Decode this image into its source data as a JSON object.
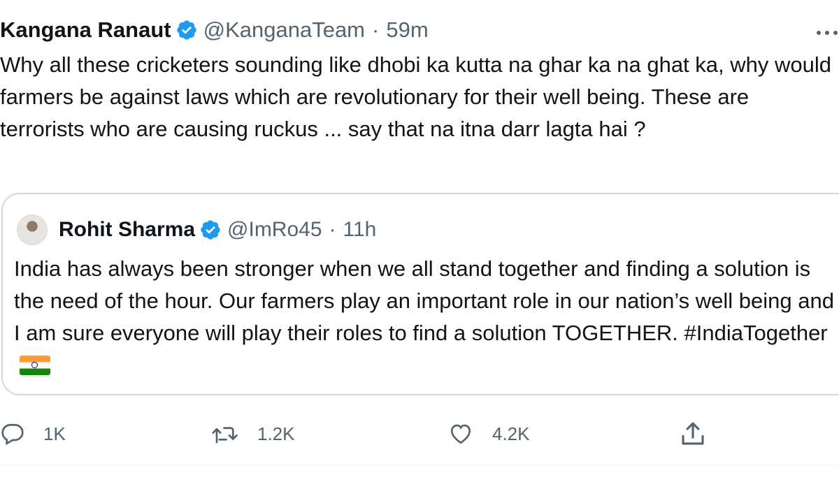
{
  "tweet": {
    "author_name": "Kangana Ranaut",
    "handle": "@KanganaTeam",
    "separator": "·",
    "time": "59m",
    "text": "Why all these cricketers sounding like dhobi ka kutta na ghar ka na ghat ka, why would farmers be against laws which are revolutionary for their well being. These are terrorists who are causing ruckus ... say that na itna darr lagta hai ?",
    "icons": {
      "verified": "verified-badge-icon",
      "more": "more-options-icon"
    }
  },
  "quote": {
    "author_name": "Rohit Sharma",
    "handle": "@ImRo45",
    "separator": "·",
    "time": "11h",
    "text": "India has always been stronger when we all stand together and finding a solution is the need of the hour. Our farmers play an important role in our nation’s well being and I am sure everyone will play their roles to find a solution TOGETHER. #IndiaTogether",
    "emoji": "india-flag-icon"
  },
  "actions": {
    "reply_count": "1K",
    "retweet_count": "1.2K",
    "like_count": "4.2K",
    "share": "share-icon"
  },
  "colors": {
    "text": "#0f1419",
    "secondary": "#536471",
    "verified": "#1d9bf0",
    "border": "#cfd9de"
  }
}
